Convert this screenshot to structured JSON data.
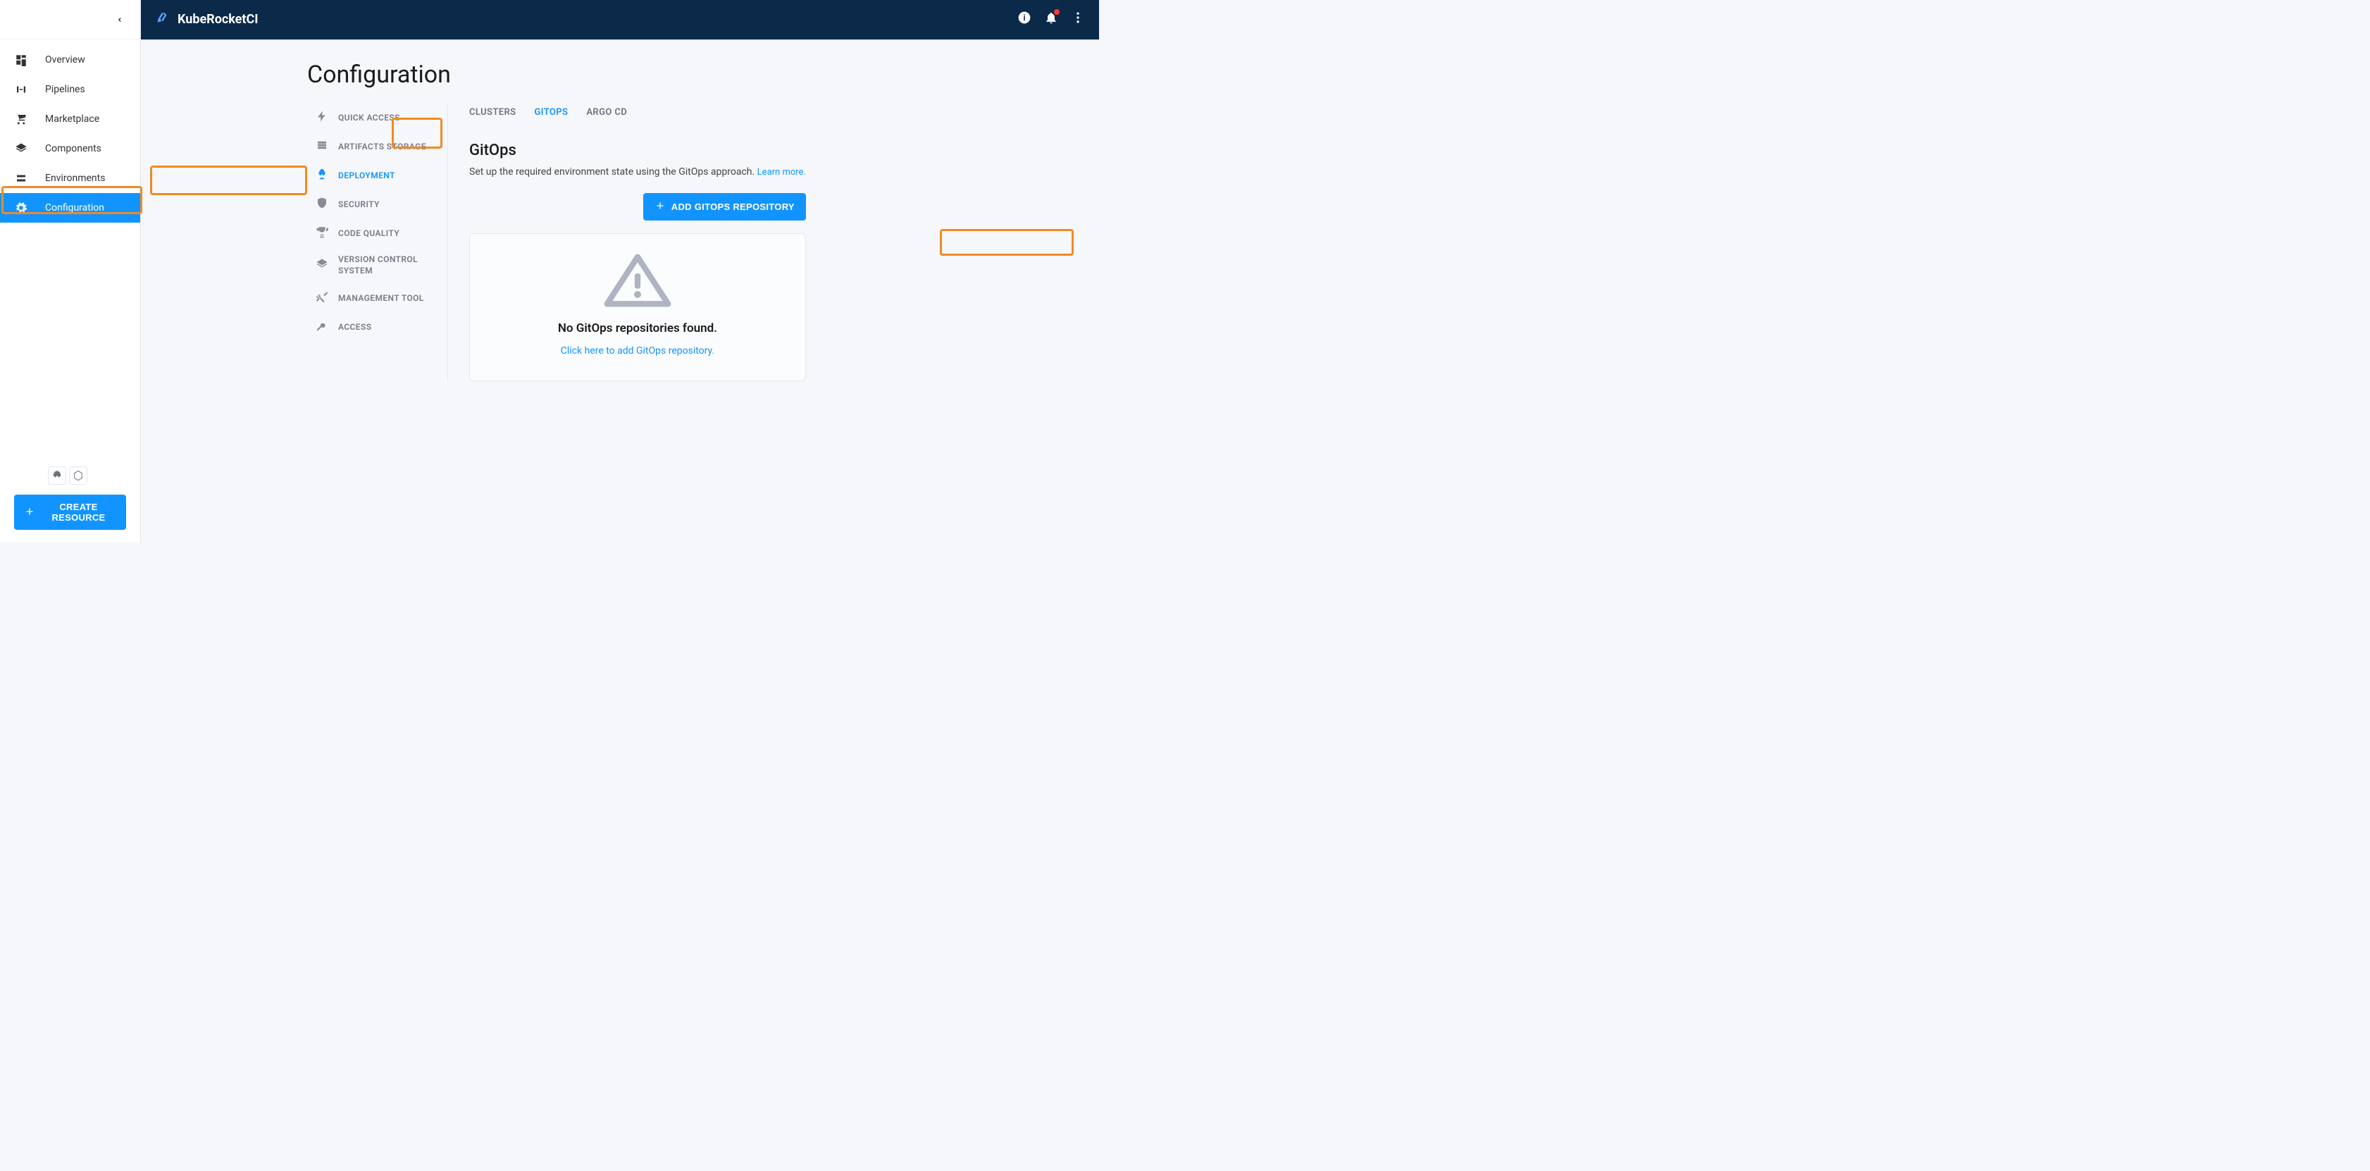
{
  "brand": {
    "name": "KubeRocketCI"
  },
  "sidebar": {
    "items": [
      {
        "label": "Overview"
      },
      {
        "label": "Pipelines"
      },
      {
        "label": "Marketplace"
      },
      {
        "label": "Components"
      },
      {
        "label": "Environments"
      },
      {
        "label": "Configuration"
      }
    ],
    "create_label": "CREATE RESOURCE"
  },
  "page": {
    "title": "Configuration"
  },
  "subnav": {
    "items": [
      {
        "label": "QUICK ACCESS"
      },
      {
        "label": "ARTIFACTS STORAGE"
      },
      {
        "label": "DEPLOYMENT"
      },
      {
        "label": "SECURITY"
      },
      {
        "label": "CODE QUALITY"
      },
      {
        "label": "VERSION CONTROL SYSTEM"
      },
      {
        "label": "MANAGEMENT TOOL"
      },
      {
        "label": "ACCESS"
      }
    ]
  },
  "tabs": {
    "items": [
      {
        "label": "CLUSTERS"
      },
      {
        "label": "GITOPS"
      },
      {
        "label": "ARGO CD"
      }
    ]
  },
  "gitops": {
    "title": "GitOps",
    "description": "Set up the required environment state using the GitOps approach.",
    "learn_more": "Learn more.",
    "add_button": "ADD GITOPS REPOSITORY",
    "empty_title": "No GitOps repositories found.",
    "empty_link": "Click here to add GitOps repository."
  }
}
